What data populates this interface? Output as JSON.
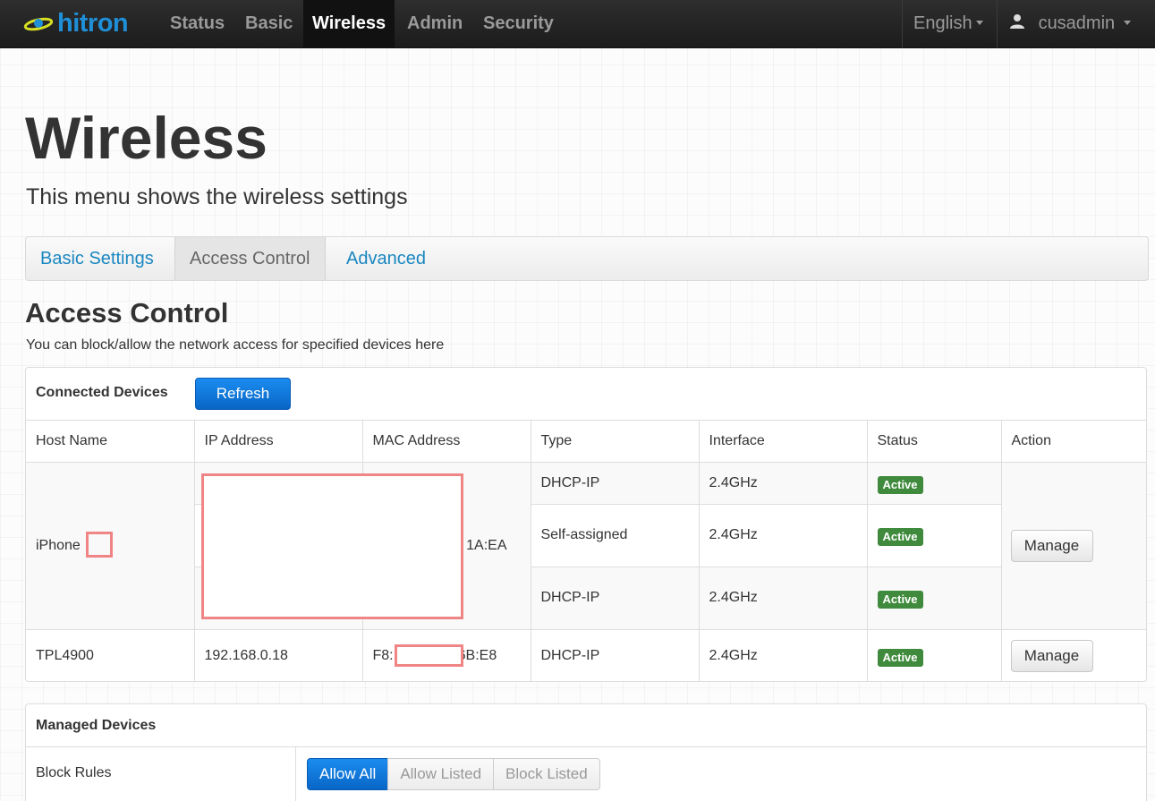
{
  "navbar": {
    "logo_text": "hitron",
    "items": [
      {
        "label": "Status"
      },
      {
        "label": "Basic"
      },
      {
        "label": "Wireless"
      },
      {
        "label": "Admin"
      },
      {
        "label": "Security"
      }
    ],
    "active": "Wireless",
    "language": "English",
    "user": "cusadmin"
  },
  "page": {
    "title": "Wireless",
    "subtitle": "This menu shows the wireless settings"
  },
  "tabs": [
    {
      "label": "Basic Settings"
    },
    {
      "label": "Access Control"
    },
    {
      "label": "Advanced"
    }
  ],
  "active_tab": "Access Control",
  "section": {
    "title": "Access Control",
    "subtitle": "You can block/allow the network access for specified devices here"
  },
  "connected": {
    "title": "Connected Devices",
    "refresh_label": "Refresh",
    "columns": [
      "Host Name",
      "IP Address",
      "MAC Address",
      "Type",
      "Interface",
      "Status",
      "Action"
    ],
    "device1": {
      "host": "iPhone",
      "mac_tail": "1A:EA",
      "rows": [
        {
          "type": "DHCP-IP",
          "interface": "2.4GHz",
          "status": "Active"
        },
        {
          "type": "Self-assigned",
          "interface": "2.4GHz",
          "status": "Active"
        },
        {
          "type": "DHCP-IP",
          "interface": "2.4GHz",
          "status": "Active"
        }
      ],
      "action": "Manage"
    },
    "device2": {
      "host": "TPL4900",
      "ip": "192.168.0.18",
      "mac_head": "F8:",
      "mac_tail": "6B:E8",
      "type": "DHCP-IP",
      "interface": "2.4GHz",
      "status": "Active",
      "action": "Manage"
    }
  },
  "managed": {
    "title": "Managed Devices",
    "block_rules_label": "Block Rules",
    "options": [
      "Allow All",
      "Allow Listed",
      "Block Listed"
    ],
    "selected": "Allow All"
  },
  "colors": {
    "accent": "#1a87c0",
    "primary_button": "#0b72d8",
    "active_badge": "#3f8a3c",
    "redaction": "#f08585"
  }
}
